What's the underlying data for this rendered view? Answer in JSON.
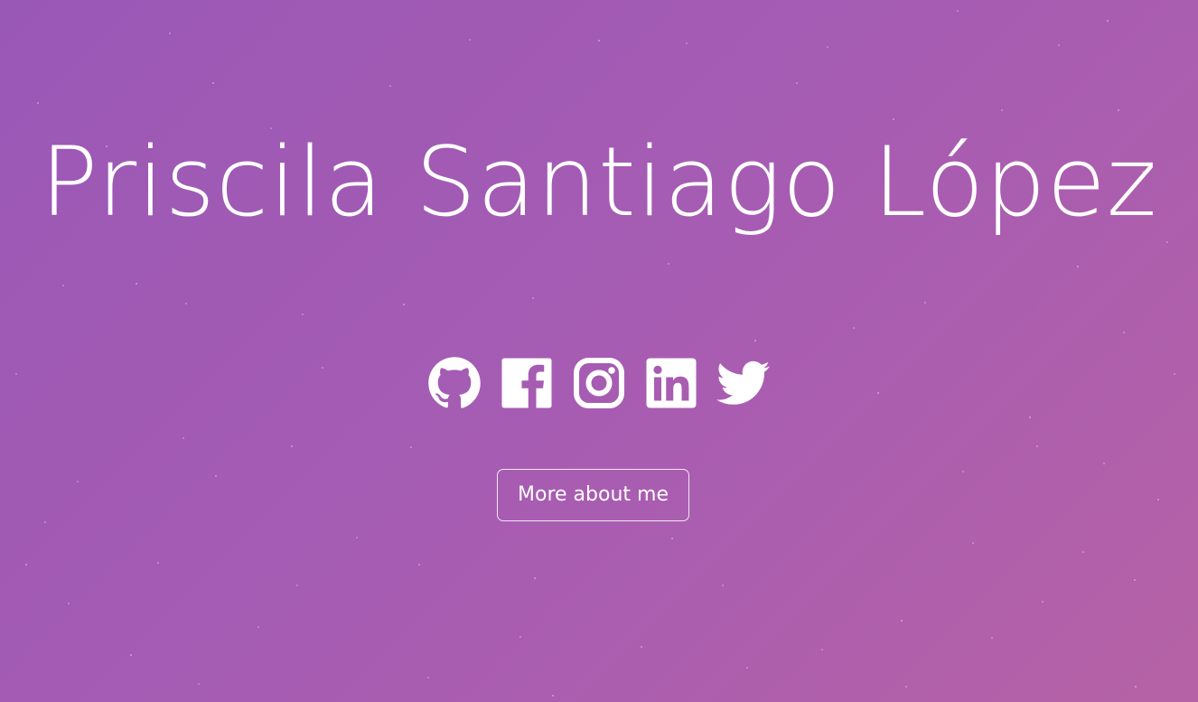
{
  "hero": {
    "name": "Priscila Santiago López"
  },
  "social_links": [
    {
      "name": "GitHub",
      "icon": "github-icon"
    },
    {
      "name": "Facebook",
      "icon": "facebook-icon"
    },
    {
      "name": "Instagram",
      "icon": "instagram-icon"
    },
    {
      "name": "LinkedIn",
      "icon": "linkedin-icon"
    },
    {
      "name": "Twitter",
      "icon": "twitter-icon"
    }
  ],
  "cta": {
    "label": "More about me"
  },
  "colors": {
    "background_start": "#9a58b6",
    "background_end": "#b662a6",
    "foreground": "#ffffff"
  }
}
